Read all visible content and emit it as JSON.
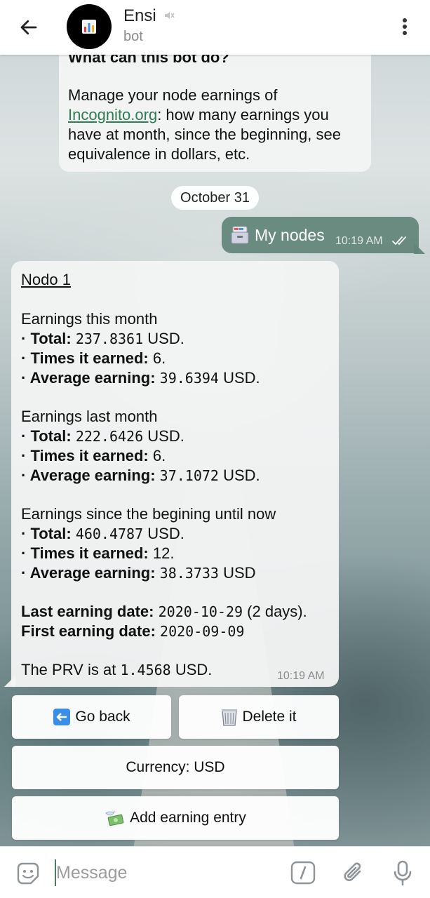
{
  "header": {
    "back_icon": "arrow-left-icon",
    "avatar_icon": "bar-chart-icon",
    "name": "Ensi",
    "status": "bot",
    "muted_icon": "speaker-muted-icon",
    "menu_icon": "more-vertical-icon"
  },
  "intro_message": {
    "title": "What can this bot do?",
    "text_before_link": "Manage your node earnings of ",
    "link": "Incognito.org",
    "text_after_link": ": how many earnings you have at month, since the beginning, see equivalence in dollars, etc."
  },
  "date_separator": "October 31",
  "outgoing_message": {
    "emoji_icon": "card-file-box-icon",
    "text": "My nodes",
    "time": "10:19 AM",
    "status_icon": "double-check-icon"
  },
  "node_message": {
    "title": "Nodo 1",
    "this_month": {
      "heading": "Earnings this month",
      "total_label": "· Total:",
      "total_value": "237.8361",
      "total_unit": "USD.",
      "times_label": "· Times it earned:",
      "times_value": "6.",
      "avg_label": "· Average earning:",
      "avg_value": "39.6394",
      "avg_unit": "USD."
    },
    "last_month": {
      "heading": "Earnings last month",
      "total_label": "· Total:",
      "total_value": "222.6426",
      "total_unit": "USD.",
      "times_label": "· Times it earned:",
      "times_value": "6.",
      "avg_label": "· Average earning:",
      "avg_value": "37.1072",
      "avg_unit": "USD."
    },
    "since_beginning": {
      "heading": "Earnings since the begining until now",
      "total_label": "· Total:",
      "total_value": "460.4787",
      "total_unit": "USD.",
      "times_label": "· Times it earned:",
      "times_value": "12.",
      "avg_label": "· Average earning:",
      "avg_value": "38.3733",
      "avg_unit": "USD"
    },
    "last_date_label": "Last earning date:",
    "last_date_value": "2020-10-29",
    "last_date_suffix": "(2 days).",
    "first_date_label": "First earning date:",
    "first_date_value": "2020-09-09",
    "prv_prefix": "The PRV is at",
    "prv_value": "1.4568",
    "prv_unit": "USD.",
    "time": "10:19 AM"
  },
  "keyboard": {
    "go_back": {
      "icon": "left-arrow-icon",
      "label": "Go back"
    },
    "delete": {
      "icon": "wastebasket-icon",
      "label": "Delete it"
    },
    "currency": {
      "label": "Currency: USD"
    },
    "add_entry": {
      "icon": "money-with-wings-icon",
      "label": "Add earning entry"
    }
  },
  "input_bar": {
    "sticker_icon": "smiley-sticker-icon",
    "placeholder": "Message",
    "command_icon": "slash-command-icon",
    "attach_icon": "paperclip-icon",
    "mic_icon": "microphone-icon"
  },
  "colors": {
    "outgoing_bubble": "#628478",
    "link": "#2e7d50",
    "keyboard_icon_blue": "#3a8ee6"
  }
}
